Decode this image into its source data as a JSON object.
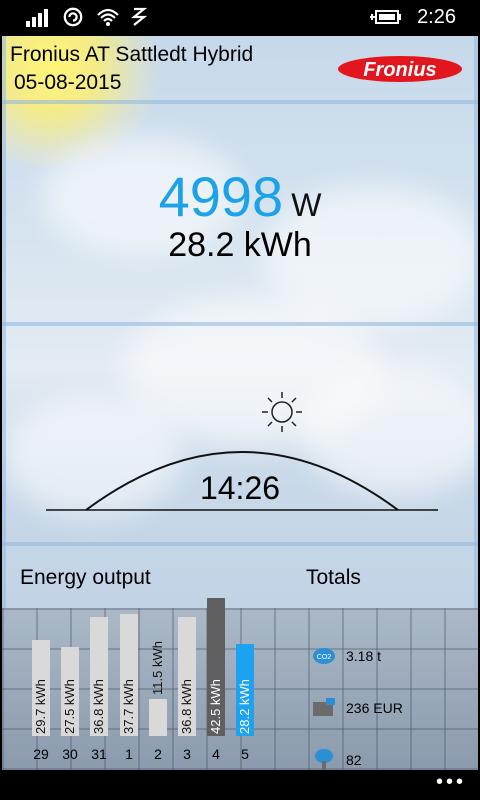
{
  "status_bar": {
    "time": "2:26",
    "icons": [
      "signal-icon",
      "data-connection-icon",
      "wifi-icon",
      "nfc-icon",
      "battery-charging-icon"
    ]
  },
  "header": {
    "title": "Fronius AT Sattledt Hybrid",
    "date": "05-08-2015",
    "logo_text": "Fronius",
    "brand_color": "#e3161e"
  },
  "current": {
    "power_value": "4998",
    "power_unit": "W",
    "energy": "28.2 kWh",
    "accent_color": "#1ca2e8"
  },
  "sun": {
    "time": "14:26"
  },
  "energy_output": {
    "title": "Energy output",
    "bars": [
      {
        "day": "29",
        "label": "29.7 kWh",
        "value": 29.7
      },
      {
        "day": "30",
        "label": "27.5 kWh",
        "value": 27.5
      },
      {
        "day": "31",
        "label": "36.8 kWh",
        "value": 36.8
      },
      {
        "day": "1",
        "label": "37.7 kWh",
        "value": 37.7
      },
      {
        "day": "2",
        "label": "11.5 kWh",
        "value": 11.5
      },
      {
        "day": "3",
        "label": "36.8 kWh",
        "value": 36.8
      },
      {
        "day": "4",
        "label": "42.5 kWh",
        "value": 42.5
      },
      {
        "day": "5",
        "label": "28.2 kWh",
        "value": 28.2
      }
    ]
  },
  "totals": {
    "title": "Totals",
    "co2": "3.18 t",
    "money": "236 EUR",
    "trees": "82"
  },
  "nav": {
    "more": "•••"
  }
}
